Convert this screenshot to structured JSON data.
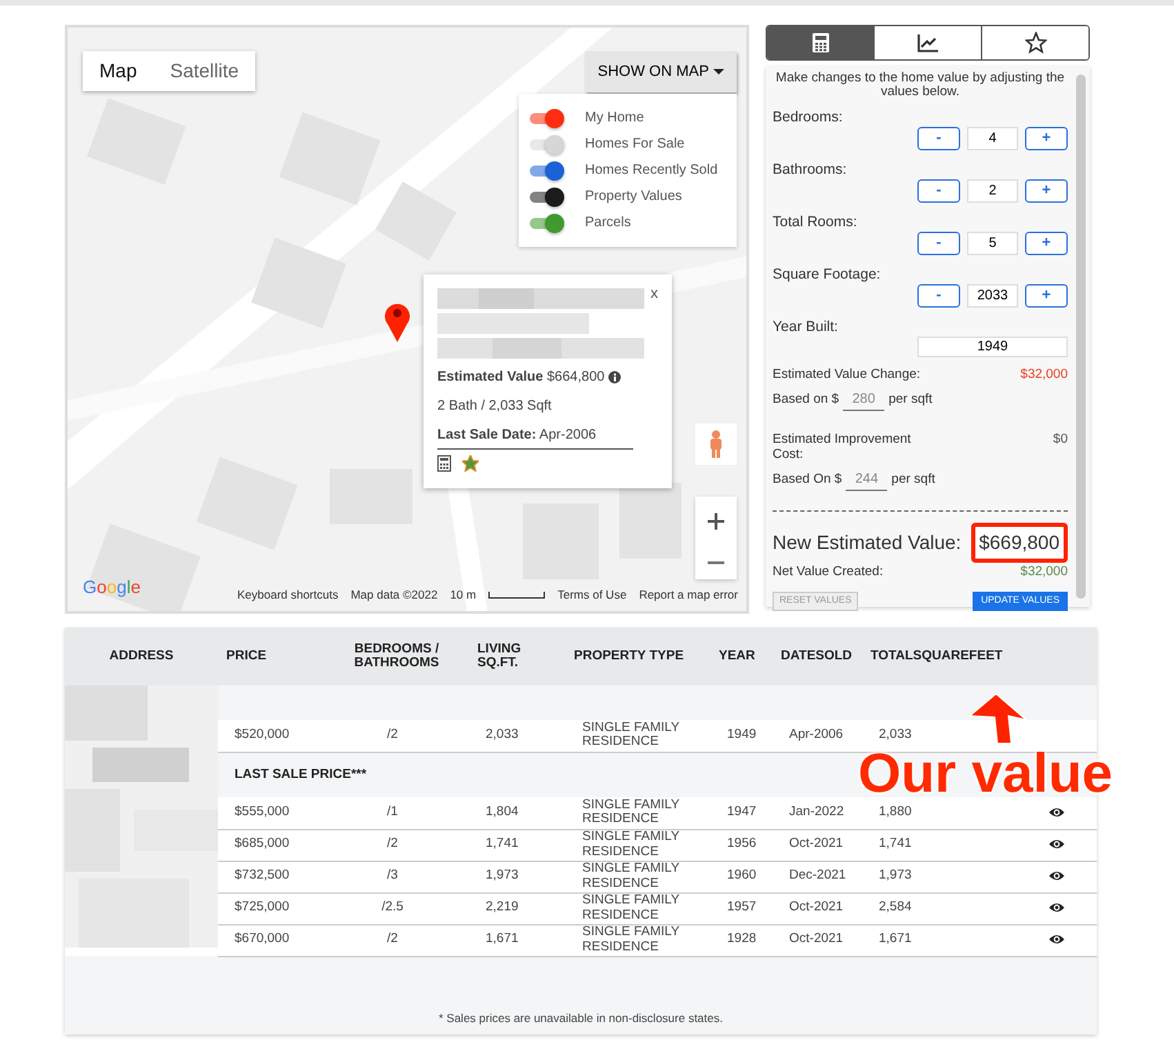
{
  "map": {
    "map_types": [
      {
        "label": "Map",
        "selected": true
      },
      {
        "label": "Satellite",
        "selected": false
      }
    ],
    "show_on_map": "SHOW ON MAP",
    "layers": [
      {
        "label": "My Home",
        "on": true,
        "color": "#ff2d10"
      },
      {
        "label": "Homes For Sale",
        "on": true,
        "color": "#d6d6d6"
      },
      {
        "label": "Homes Recently Sold",
        "on": true,
        "color": "#1a62d6"
      },
      {
        "label": "Property Values",
        "on": true,
        "color": "#1b1b1b"
      },
      {
        "label": "Parcels",
        "on": true,
        "color": "#3f9a2f"
      }
    ],
    "popup": {
      "close": "x",
      "estimate_label": "Estimated Value",
      "estimate": "$664,800",
      "details": "2 Bath / 2,033 Sqft",
      "sale_label": "Last Sale Date:",
      "sale_date": "Apr-2006"
    },
    "logo": "Google",
    "attributions": [
      "Keyboard shortcuts",
      "Map data ©2022",
      "10 m",
      "Terms of Use",
      "Report a map error"
    ]
  },
  "tabs": [
    {
      "kind": "calculator",
      "selected": true
    },
    {
      "kind": "chart",
      "selected": false
    },
    {
      "kind": "star",
      "selected": false
    }
  ],
  "calculator": {
    "intro": "Make changes to the home value by adjusting the values below.",
    "steppers": [
      {
        "label": "Bedrooms:",
        "minus": "-",
        "value": "4",
        "plus": "+"
      },
      {
        "label": "Bathrooms:",
        "minus": "-",
        "value": "2",
        "plus": "+"
      },
      {
        "label": "Total Rooms:",
        "minus": "-",
        "value": "5",
        "plus": "+"
      },
      {
        "label": "Square Footage:",
        "minus": "-",
        "value": "2033",
        "plus": "+"
      }
    ],
    "year_built": {
      "label": "Year Built:",
      "value": "1949"
    },
    "value_change": {
      "label": "Estimated Value Change:",
      "amount": "$32,000",
      "prefix": "Based on $",
      "rate": "280",
      "suffix": "per sqft"
    },
    "improvement": {
      "label": "Estimated Improvement Cost:",
      "amount": "$0",
      "prefix": "Based On $",
      "rate": "244",
      "suffix": "per sqft"
    },
    "new_value": {
      "label": "New Estimated Value:",
      "amount": "$669,800"
    },
    "net_value": {
      "label": "Net Value Created:",
      "amount": "$32,000"
    },
    "buttons": [
      "RESET VALUES",
      "UPDATE VALUES"
    ]
  },
  "table": {
    "columns": [
      "ADDRESS",
      "PRICE",
      "BEDROOMS / BATHROOMS",
      "LIVING SQ.FT.",
      "PROPERTY TYPE",
      "YEAR",
      "DATESOLD",
      "TOTALSQUAREFEET"
    ],
    "rows": [
      {
        "kind": "spacer"
      },
      {
        "kind": "subject",
        "cells": [
          "$520,000",
          "/2",
          "2,033",
          "SINGLE FAMILY RESIDENCE",
          "1949",
          "Apr-2006",
          "2,033"
        ]
      },
      {
        "kind": "section",
        "label": "LAST SALE PRICE***"
      },
      {
        "kind": "comp",
        "cells": [
          "$555,000",
          "/1",
          "1,804",
          "SINGLE FAMILY RESIDENCE",
          "1947",
          "Jan-2022",
          "1,880"
        ]
      },
      {
        "kind": "comp",
        "cells": [
          "$685,000",
          "/2",
          "1,741",
          "SINGLE FAMILY RESIDENCE",
          "1956",
          "Oct-2021",
          "1,741"
        ]
      },
      {
        "kind": "comp",
        "cells": [
          "$732,500",
          "/3",
          "1,973",
          "SINGLE FAMILY RESIDENCE",
          "1960",
          "Dec-2021",
          "1,973"
        ]
      },
      {
        "kind": "comp",
        "cells": [
          "$725,000",
          "/2.5",
          "2,219",
          "SINGLE FAMILY RESIDENCE",
          "1957",
          "Oct-2021",
          "2,584"
        ]
      },
      {
        "kind": "comp",
        "cells": [
          "$670,000",
          "/2",
          "1,671",
          "SINGLE FAMILY RESIDENCE",
          "1928",
          "Oct-2021",
          "1,671"
        ]
      }
    ],
    "footnote": "* Sales prices are unavailable in non-disclosure states."
  },
  "annotation": {
    "label": "Our value"
  }
}
